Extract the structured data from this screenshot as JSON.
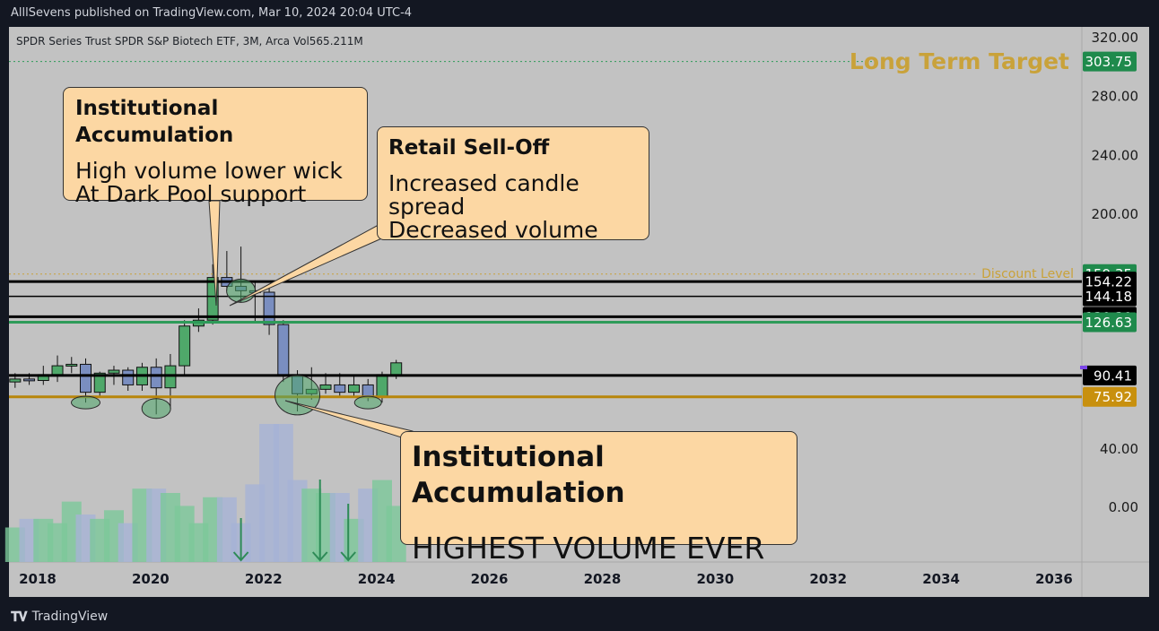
{
  "header": {
    "publisher_line": "AlllSevens published on TradingView.com, Mar 10, 2024 20:04 UTC-4"
  },
  "footer": {
    "brand": "TradingView",
    "logo_icon": "tradingview-logo-icon"
  },
  "colors": {
    "bull": "#4fa86a",
    "bear": "#7a8ec0",
    "vol_bull": "#7cc89a",
    "vol_bear": "#a6b3d6",
    "green_level": "#2e9b59",
    "gold_level": "#b8860b",
    "target_text": "#c9a23a",
    "discount_text": "#c9a23a",
    "callout_bg": "#fcd7a3",
    "plot_bg": "#c2c2c2"
  },
  "chart_data": {
    "type": "candlestick",
    "symbol_line": "SPDR Series Trust SPDR S&P Biotech ETF, 3M, Arca  Vol565.211M",
    "y_ticks": [
      "320.00",
      "280.00",
      "240.00",
      "200.00",
      "40.00",
      "0.00"
    ],
    "x_ticks": [
      "2018",
      "2020",
      "2022",
      "2024",
      "2026",
      "2028",
      "2030",
      "2032",
      "2034",
      "2036"
    ],
    "ylim": [
      -20,
      330
    ],
    "xlim": [
      2017.5,
      2037.0
    ],
    "candles": [
      {
        "t": 2017.6,
        "o": 86,
        "h": 92,
        "l": 82,
        "c": 88
      },
      {
        "t": 2017.85,
        "o": 88,
        "h": 92,
        "l": 84,
        "c": 87
      },
      {
        "t": 2018.1,
        "o": 87,
        "h": 97,
        "l": 84,
        "c": 91
      },
      {
        "t": 2018.35,
        "o": 91,
        "h": 104,
        "l": 86,
        "c": 97
      },
      {
        "t": 2018.6,
        "o": 97,
        "h": 103,
        "l": 92,
        "c": 98
      },
      {
        "t": 2018.85,
        "o": 98,
        "h": 102,
        "l": 72,
        "c": 79
      },
      {
        "t": 2019.1,
        "o": 79,
        "h": 93,
        "l": 76,
        "c": 92
      },
      {
        "t": 2019.35,
        "o": 92,
        "h": 97,
        "l": 84,
        "c": 94
      },
      {
        "t": 2019.6,
        "o": 94,
        "h": 96,
        "l": 80,
        "c": 84
      },
      {
        "t": 2019.85,
        "o": 84,
        "h": 99,
        "l": 80,
        "c": 96
      },
      {
        "t": 2020.1,
        "o": 96,
        "h": 102,
        "l": 64,
        "c": 82
      },
      {
        "t": 2020.35,
        "o": 82,
        "h": 105,
        "l": 68,
        "c": 97
      },
      {
        "t": 2020.6,
        "o": 97,
        "h": 128,
        "l": 90,
        "c": 124
      },
      {
        "t": 2020.85,
        "o": 124,
        "h": 136,
        "l": 120,
        "c": 128
      },
      {
        "t": 2021.1,
        "o": 128,
        "h": 166,
        "l": 125,
        "c": 157
      },
      {
        "t": 2021.35,
        "o": 157,
        "h": 175,
        "l": 148,
        "c": 151
      },
      {
        "t": 2021.6,
        "o": 151,
        "h": 178,
        "l": 140,
        "c": 148
      },
      {
        "t": 2021.85,
        "o": 148,
        "h": 154,
        "l": 127,
        "c": 147
      },
      {
        "t": 2022.1,
        "o": 147,
        "h": 150,
        "l": 118,
        "c": 125
      },
      {
        "t": 2022.35,
        "o": 125,
        "h": 128,
        "l": 86,
        "c": 91
      },
      {
        "t": 2022.6,
        "o": 91,
        "h": 94,
        "l": 66,
        "c": 78
      },
      {
        "t": 2022.85,
        "o": 78,
        "h": 96,
        "l": 74,
        "c": 81
      },
      {
        "t": 2023.1,
        "o": 81,
        "h": 92,
        "l": 78,
        "c": 84
      },
      {
        "t": 2023.35,
        "o": 84,
        "h": 92,
        "l": 76,
        "c": 79
      },
      {
        "t": 2023.6,
        "o": 79,
        "h": 90,
        "l": 76,
        "c": 84
      },
      {
        "t": 2023.85,
        "o": 84,
        "h": 88,
        "l": 73,
        "c": 76
      },
      {
        "t": 2024.1,
        "o": 76,
        "h": 93,
        "l": 72,
        "c": 91
      },
      {
        "t": 2024.35,
        "o": 91,
        "h": 101,
        "l": 88,
        "c": 99
      }
    ],
    "volume": [
      8,
      10,
      10,
      9,
      14,
      11,
      10,
      12,
      9,
      17,
      17,
      16,
      13,
      9,
      15,
      15,
      9,
      18,
      32,
      32,
      19,
      17,
      16,
      16,
      10,
      17,
      19,
      13
    ],
    "levels": [
      {
        "value": 303.75,
        "label": "303.75",
        "badge": "#1f8a4c",
        "text": "#ffffff",
        "line": "dotted-green"
      },
      {
        "value": 159.35,
        "label": "159.35",
        "badge": "#1f8a4c",
        "text": "#ffffff",
        "line": "dotted-gold"
      },
      {
        "value": 154.22,
        "label": "154.22",
        "badge": "#000000",
        "text": "#ffffff",
        "line": "solid-black"
      },
      {
        "value": 144.18,
        "label": "144.18",
        "badge": "#000000",
        "text": "#ffffff",
        "line": "thin-black"
      },
      {
        "value": 130.3,
        "label": "130.30",
        "badge": "#000000",
        "text": "#ffffff",
        "line": "solid-black"
      },
      {
        "value": 126.63,
        "label": "126.63",
        "badge": "#1f8a4c",
        "text": "#ffffff",
        "line": "solid-green"
      },
      {
        "value": 90.41,
        "label": "90.41",
        "badge": "#000000",
        "text": "#ffffff",
        "line": "solid-black"
      },
      {
        "value": 75.92,
        "label": "75.92",
        "badge": "#c8900e",
        "text": "#ffffff",
        "line": "solid-gold"
      }
    ],
    "annotations": {
      "long_term_target": "Long Term Target",
      "discount_level": "Discount Level"
    },
    "volume_arrows": [
      "down-arrow-icon",
      "down-arrow-icon",
      "down-arrow-icon"
    ]
  },
  "callouts": [
    {
      "id": "inst1",
      "title": "Institutional Accumulation",
      "lines": [
        "High volume lower wick",
        "At Dark Pool support"
      ]
    },
    {
      "id": "retail",
      "title": "Retail Sell-Off",
      "lines": [
        "Increased candle spread",
        "Decreased volume"
      ]
    },
    {
      "id": "inst2",
      "title": "Institutional Accumulation",
      "lines": [
        "HIGHEST VOLUME EVER"
      ]
    }
  ]
}
